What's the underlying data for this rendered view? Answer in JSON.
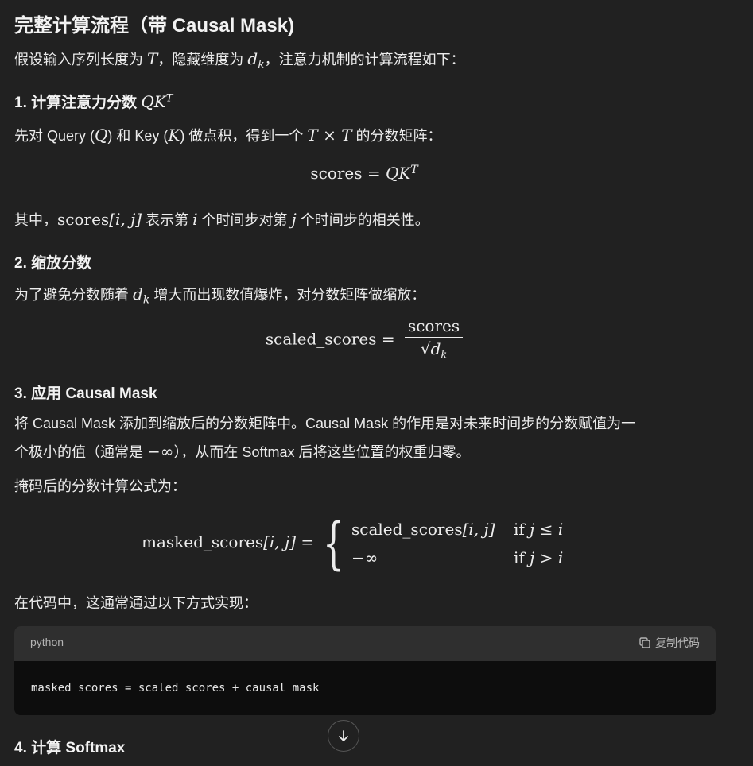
{
  "title": "完整计算流程（带 Causal Mask)",
  "intro": {
    "pre": "假设输入序列长度为 ",
    "T": "T",
    "mid": "，隐藏维度为 ",
    "d": "d",
    "k": "k",
    "post": "，注意力机制的计算流程如下："
  },
  "section1": {
    "heading": "1. 计算注意力分数 ",
    "heading_math": "QK",
    "heading_sup": "T",
    "text_pre": "先对 Query (",
    "Q": "Q",
    "text_mid1": ") 和 Key (",
    "K": "K",
    "text_mid2": ") 做点积，得到一个 ",
    "TxT": "T × T",
    "text_post": " 的分数矩阵：",
    "formula_lhs": "scores",
    "formula_eq": " = ",
    "formula_rhs": "QK",
    "formula_sup": "T",
    "note_pre": "其中，",
    "note_math_rm": "scores",
    "note_math_it": "[i, j]",
    "note_mid": " 表示第 ",
    "note_i": "i",
    "note_mid2": " 个时间步对第 ",
    "note_j": "j",
    "note_post": " 个时间步的相关性。"
  },
  "section2": {
    "heading": "2. 缩放分数",
    "text_pre": "为了避免分数随着 ",
    "d": "d",
    "k": "k",
    "text_post": " 增大而出现数值爆炸，对分数矩阵做缩放：",
    "formula_lhs": "scaled_scores",
    "formula_eq": " = ",
    "num": "scores",
    "den_sqrt": "√",
    "den_d": "d",
    "den_k": "k"
  },
  "section3": {
    "heading": "3. 应用 Causal Mask",
    "text_line1": "将 Causal Mask 添加到缩放后的分数矩阵中。Causal Mask 的作用是对未来时间步的分数赋值为一",
    "text_line2_pre": "个极小的值（通常是 ",
    "text_line2_math": "−∞",
    "text_line2_post": "），从而在 Softmax 后将这些位置的权重归零。",
    "formula_intro": "掩码后的分数计算公式为：",
    "lhs_rm": "masked_scores",
    "lhs_it": "[i, j]",
    "lhs_eq": " = ",
    "case1_val_rm": "scaled_scores",
    "case1_val_it": "[i, j]",
    "case1_cond_rm": "if ",
    "case1_cond_it": "j ≤ i",
    "case2_val": "−∞",
    "case2_cond_rm": "if ",
    "case2_cond_it": "j > i",
    "code_intro": "在代码中，这通常通过以下方式实现："
  },
  "codeblock": {
    "language": "python",
    "copy_label": "复制代码",
    "code": "masked_scores = scaled_scores + causal_mask"
  },
  "section4": {
    "heading": "4. 计算 Softmax"
  },
  "icons": {
    "copy": "copy-icon",
    "scroll_down": "arrow-down-icon"
  }
}
